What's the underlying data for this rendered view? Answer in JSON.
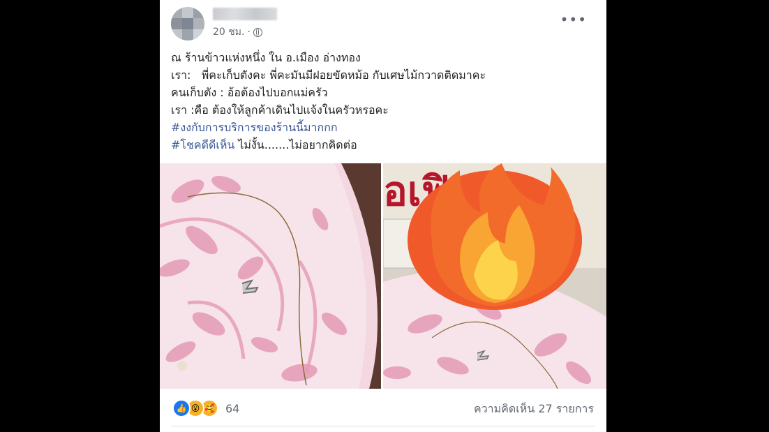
{
  "post": {
    "author_name": "",
    "timestamp": "20 ชม.",
    "separator": "·",
    "more_icon": "more-horizontal-icon",
    "privacy_icon": "globe-icon",
    "lines": [
      "ณ ร้านข้าวแห่งหนึ่ง ใน อ.เมือง อ่างทอง",
      "เรา:   พี่คะเก็บตังคะ พี่คะมันมีฝอยขัดหม้อ กับเศษไม้กวาดติดมาคะ",
      "คนเก็บตัง : อ้อต้องไปบอกแม่ครัว",
      "เรา :คือ ต้องให้ลูกค้าเดินไปแจ้งในครัวหรอคะ"
    ],
    "hashtag1": "#งงกับการบริการของร้านนี้มากกก",
    "hashtag2": "#โชคดีดีเห็น",
    "line_end": " ไม่งั้น.......ไม่อยากคิดต่อ",
    "photos": [
      "plate-with-steel-wool-hair",
      "plate-with-fire-emoji-sticker"
    ],
    "reactions": [
      "like",
      "wow",
      "care"
    ],
    "reaction_count": "64",
    "comment_count": "ความคิดเห็น 27 รายการ",
    "colors": {
      "background": "#000000",
      "card": "#ffffff",
      "hashtag": "#385898",
      "meta": "#606770",
      "like": "#1877f2"
    }
  }
}
